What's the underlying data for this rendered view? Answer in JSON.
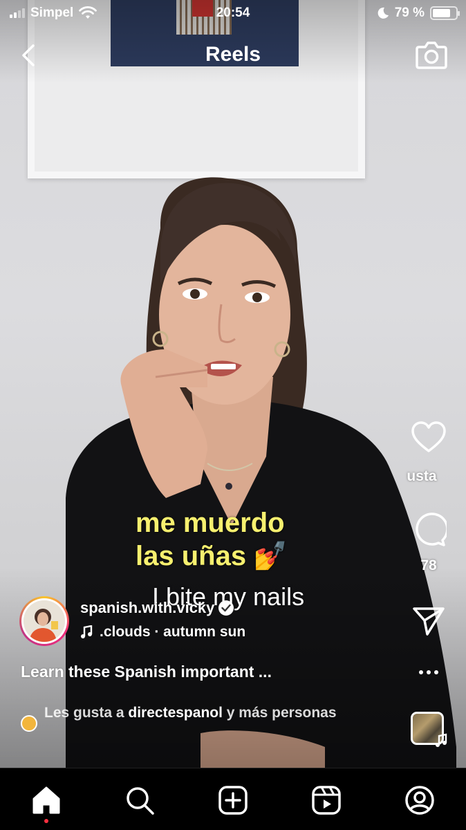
{
  "status_bar": {
    "carrier": "Simpel",
    "time": "20:54",
    "battery": "79 %",
    "battery_level": 0.79
  },
  "header": {
    "title": "Reels"
  },
  "video": {
    "caption_spanish_line1": "me muerdo",
    "caption_spanish_line2": "las uñas",
    "caption_emoji": "💅",
    "caption_english": "I bite my nails"
  },
  "actions": {
    "like_label": "usta",
    "comment_count": "78"
  },
  "post": {
    "username": "spanish.with.vicky",
    "audio": ".clouds · autumn sun",
    "caption": "Learn these Spanish important ...",
    "liked_by_prefix": "Les gusta a ",
    "liked_by_user": "directespanol",
    "liked_by_suffix": " y más personas"
  },
  "icons": {
    "back": "chevron-left-icon",
    "camera": "camera-icon",
    "like": "heart-icon",
    "comment": "comment-icon",
    "share": "paper-plane-icon",
    "more": "more-icon",
    "home": "home-icon",
    "search": "search-icon",
    "create": "plus-square-icon",
    "reels": "reels-icon",
    "profile": "profile-icon"
  }
}
